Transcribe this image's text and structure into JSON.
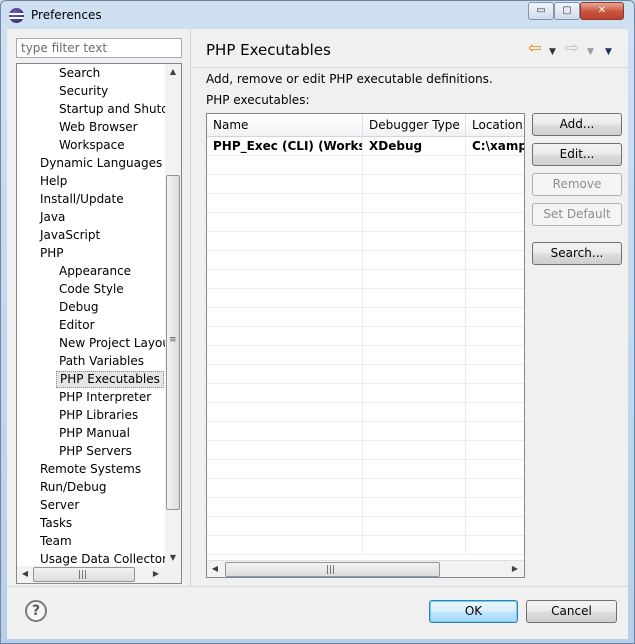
{
  "window": {
    "title": "Preferences",
    "minimize_glyph": "▭",
    "maximize_glyph": "▢",
    "close_glyph": "✕"
  },
  "filter": {
    "placeholder": "type filter text",
    "value": ""
  },
  "tree": {
    "items": [
      {
        "label": "Search",
        "level": 2
      },
      {
        "label": "Security",
        "level": 2
      },
      {
        "label": "Startup and Shutdown",
        "level": 2
      },
      {
        "label": "Web Browser",
        "level": 2
      },
      {
        "label": "Workspace",
        "level": 2
      },
      {
        "label": "Dynamic Languages",
        "level": 1
      },
      {
        "label": "Help",
        "level": 1
      },
      {
        "label": "Install/Update",
        "level": 1
      },
      {
        "label": "Java",
        "level": 1
      },
      {
        "label": "JavaScript",
        "level": 1
      },
      {
        "label": "PHP",
        "level": 1
      },
      {
        "label": "Appearance",
        "level": 2
      },
      {
        "label": "Code Style",
        "level": 2
      },
      {
        "label": "Debug",
        "level": 2
      },
      {
        "label": "Editor",
        "level": 2
      },
      {
        "label": "New Project Layout",
        "level": 2
      },
      {
        "label": "Path Variables",
        "level": 2
      },
      {
        "label": "PHP Executables",
        "level": 2,
        "selected": true
      },
      {
        "label": "PHP Interpreter",
        "level": 2
      },
      {
        "label": "PHP Libraries",
        "level": 2
      },
      {
        "label": "PHP Manual",
        "level": 2
      },
      {
        "label": "PHP Servers",
        "level": 2
      },
      {
        "label": "Remote Systems",
        "level": 1
      },
      {
        "label": "Run/Debug",
        "level": 1
      },
      {
        "label": "Server",
        "level": 1
      },
      {
        "label": "Tasks",
        "level": 1
      },
      {
        "label": "Team",
        "level": 1
      },
      {
        "label": "Usage Data Collector",
        "level": 1
      }
    ]
  },
  "page": {
    "title": "PHP Executables",
    "description": "Add, remove or edit PHP executable definitions.",
    "list_label": "PHP executables:"
  },
  "table": {
    "columns": [
      "Name",
      "Debugger Type",
      "Location"
    ],
    "rows": [
      [
        "PHP_Exec (CLI) (Workspace Default)",
        "XDebug",
        "C:\\xampp"
      ]
    ]
  },
  "buttons": {
    "add": "Add...",
    "edit": "Edit...",
    "remove": "Remove",
    "set_default": "Set Default",
    "search": "Search...",
    "ok": "OK",
    "cancel": "Cancel"
  },
  "icons": {
    "help": "?",
    "nav_back": "⇦",
    "nav_forward": "⇨",
    "dropdown": "▼"
  },
  "colors": {
    "accent_back_arrow": "#d88b12",
    "default_button_border": "#3c7fb1"
  }
}
